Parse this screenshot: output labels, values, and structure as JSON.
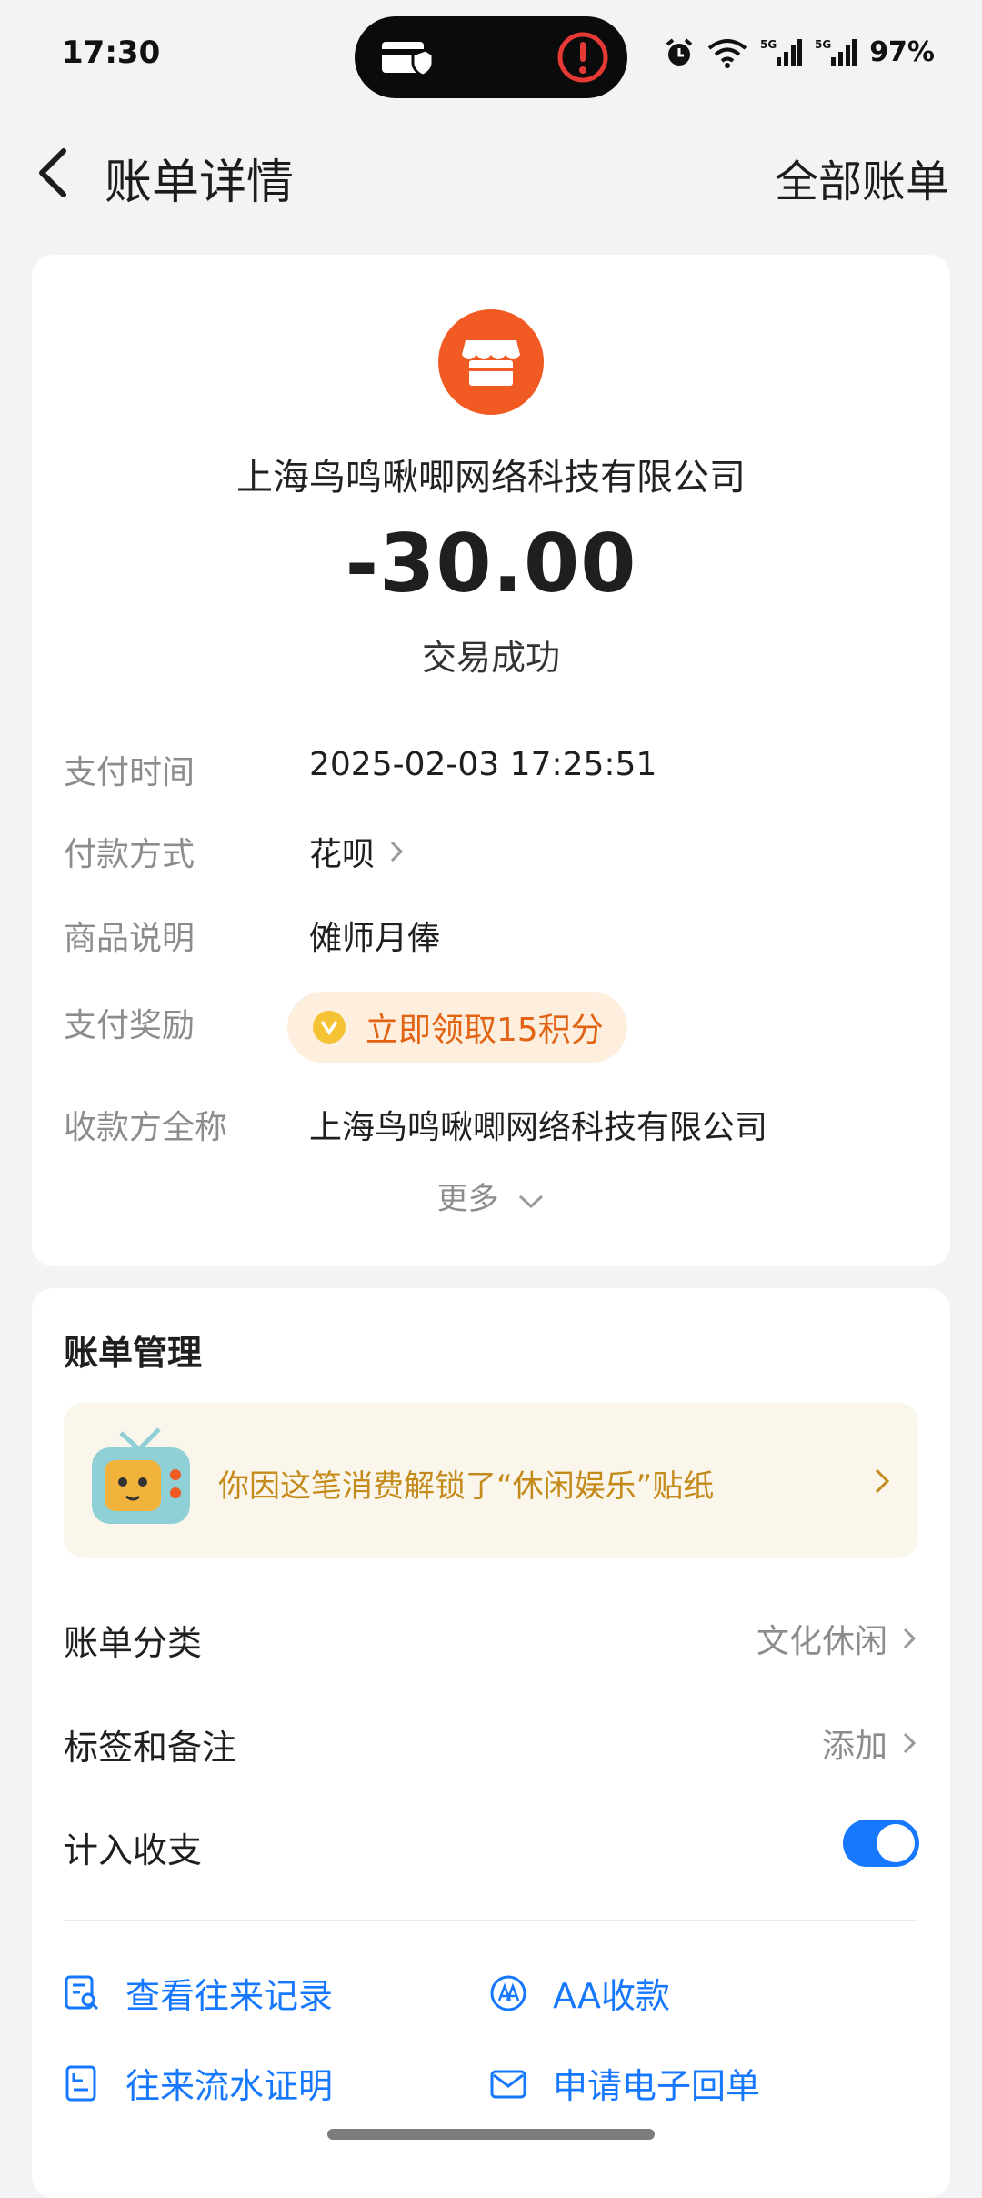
{
  "status_bar": {
    "time": "17:30",
    "battery": "97%",
    "icons": [
      "card-shield-icon",
      "alert-icon",
      "alarm-icon",
      "wifi-icon",
      "signal-5g-icon",
      "signal-5g-icon"
    ]
  },
  "header": {
    "title": "账单详情",
    "right_link": "全部账单"
  },
  "summary": {
    "merchant_icon": "store-icon",
    "merchant_name": "上海鸟鸣啾唧网络科技有限公司",
    "amount": "-30.00",
    "status": "交易成功"
  },
  "details": {
    "pay_time_label": "支付时间",
    "pay_time_value": "2025-02-03 17:25:51",
    "pay_method_label": "付款方式",
    "pay_method_value": "花呗",
    "product_label": "商品说明",
    "product_value": "傩师月俸",
    "reward_label": "支付奖励",
    "reward_value": "立即领取15积分",
    "payee_label": "收款方全称",
    "payee_value": "上海鸟鸣啾唧网络科技有限公司",
    "more": "更多"
  },
  "management": {
    "title": "账单管理",
    "sticker_text": "你因这笔消费解锁了“休闲娱乐”贴纸",
    "category_label": "账单分类",
    "category_value": "文化休闲",
    "tags_label": "标签和备注",
    "tags_value": "添加",
    "income_label": "计入收支",
    "income_enabled": true
  },
  "actions": {
    "view_records": "查看往来记录",
    "aa": "AA收款",
    "statement": "往来流水证明",
    "receipt": "申请电子回单"
  },
  "colors": {
    "accent": "#1677ff",
    "merchant": "#f25a24",
    "reward_text": "#e26314",
    "sticker_text": "#c48a1a"
  }
}
